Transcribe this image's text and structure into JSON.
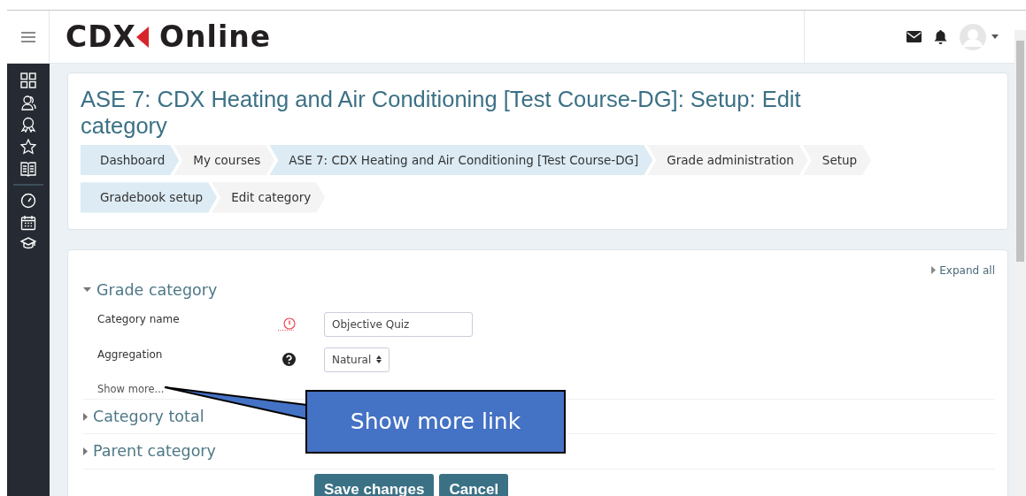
{
  "header": {
    "logo_brand": "CDX",
    "logo_product": "Online"
  },
  "page_title": "ASE 7: CDX Heating and Air Conditioning [Test Course-DG]: Setup: Edit category",
  "breadcrumbs": [
    {
      "label": "Dashboard",
      "highlighted": true
    },
    {
      "label": "My courses",
      "highlighted": false
    },
    {
      "label": "ASE 7: CDX Heating and Air Conditioning [Test Course-DG]",
      "highlighted": true
    },
    {
      "label": "Grade administration",
      "highlighted": false
    },
    {
      "label": "Setup",
      "highlighted": false
    },
    {
      "label": "Gradebook setup",
      "highlighted": true
    },
    {
      "label": "Edit category",
      "highlighted": false
    }
  ],
  "form": {
    "expand_all": "Expand all",
    "sections": [
      {
        "title": "Grade category",
        "expanded": true,
        "fields": [
          {
            "label": "Category name",
            "kind": "text",
            "indicator": {
              "kind": "required"
            },
            "value": "Objective Quiz"
          },
          {
            "label": "Aggregation",
            "kind": "select",
            "indicator": {
              "kind": "help"
            },
            "value": "Natural"
          }
        ],
        "show_more": "Show more..."
      },
      {
        "title": "Category total",
        "expanded": false
      },
      {
        "title": "Parent category",
        "expanded": false
      }
    ],
    "buttons": [
      "Save changes",
      "Cancel"
    ]
  },
  "callout": {
    "text": "Show more link"
  }
}
